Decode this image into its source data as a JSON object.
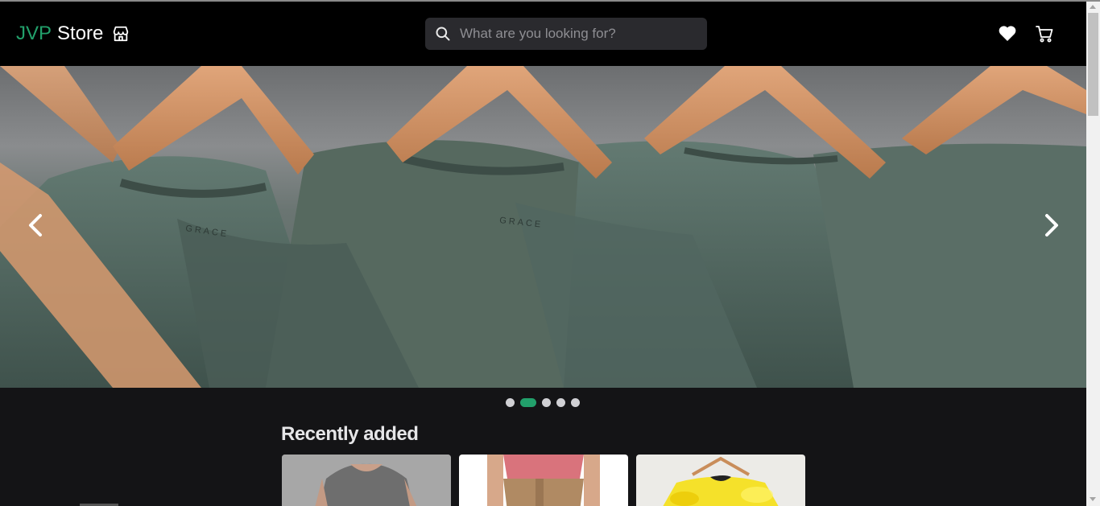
{
  "header": {
    "brand": "JVP",
    "store": "Store",
    "store_icon": "storefront-icon",
    "search": {
      "placeholder": "What are you looking for?",
      "value": "",
      "icon": "search-icon"
    },
    "favorites_icon": "heart-icon",
    "cart_icon": "cart-icon"
  },
  "carousel": {
    "prev_icon": "chevron-left-icon",
    "next_icon": "chevron-right-icon",
    "slide_count": 5,
    "active_index": 1,
    "logo_text": "GRACE"
  },
  "recent": {
    "title": "Recently added",
    "products": [
      {
        "name": "grey tank top"
      },
      {
        "name": "pink t-shirt"
      },
      {
        "name": "yellow tie-dye top"
      }
    ]
  },
  "colors": {
    "accent": "#22a06b",
    "background": "#141416",
    "header": "#000000"
  }
}
